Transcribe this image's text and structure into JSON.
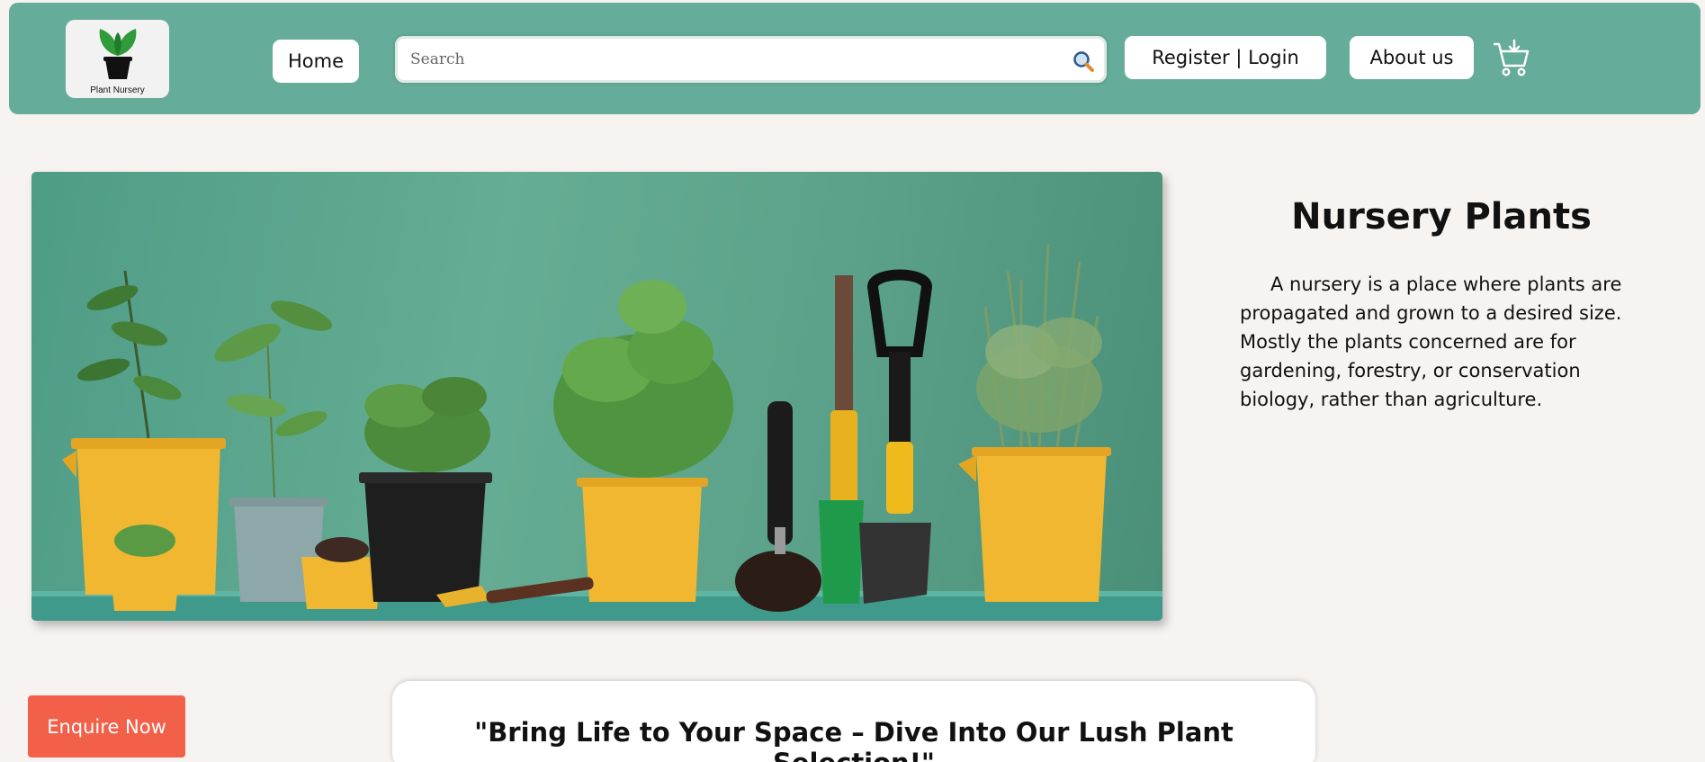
{
  "header": {
    "logo_text": "Plant Nursery",
    "home_label": "Home",
    "search_placeholder": "Search",
    "register_label": "Register | Login",
    "about_label": "About us"
  },
  "hero": {
    "title": "Nursery Plants",
    "description": "A nursery is a place where plants are propagated and grown to a desired size. Mostly the plants concerned are for gardening, forestry, or conservation biology, rather than agriculture."
  },
  "enquire_label": "Enquire Now",
  "tagline": "\"Bring Life to Your Space – Dive Into Our Lush Plant Selection!\"",
  "colors": {
    "header_bg": "#65ac9a",
    "page_bg": "#f7f3f0",
    "accent": "#f2604a"
  },
  "icons": [
    "search-icon",
    "cart-icon",
    "plant-logo-icon"
  ]
}
